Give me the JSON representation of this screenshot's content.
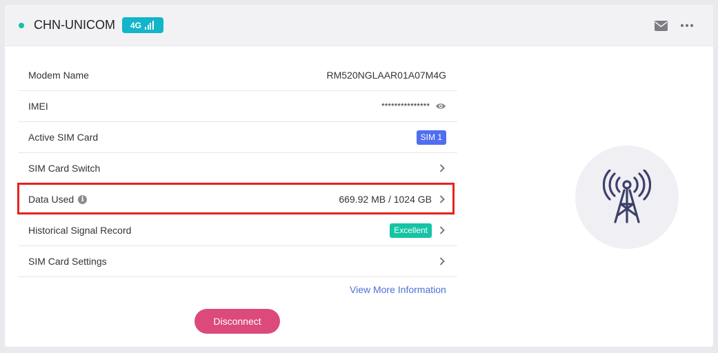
{
  "header": {
    "carrier": "CHN-UNICOM",
    "network_type": "4G",
    "status_color": "#13c2a6",
    "icons": [
      "mail-icon",
      "more-icon"
    ]
  },
  "rows": [
    {
      "label": "Modem Name",
      "value": "RM520NGLAAR01A07M4G"
    },
    {
      "label": "IMEI",
      "value": "***************",
      "icon": "eye-icon"
    },
    {
      "label": "Active SIM Card",
      "badge": "SIM 1"
    },
    {
      "label": "SIM Card Switch",
      "icon": "chevron-right-icon"
    },
    {
      "label": "Data Used",
      "value": "669.92 MB / 1024 GB",
      "icon": "chevron-right-icon",
      "highlighted": true
    },
    {
      "label": "Historical Signal Record",
      "badge": "Excellent",
      "icon": "chevron-right-icon"
    },
    {
      "label": "SIM Card Settings",
      "icon": "chevron-right-icon"
    }
  ],
  "info_glyph": "i",
  "more_link": "View More Information",
  "disconnect_label": "Disconnect",
  "colors": {
    "accent_link": "#4b70d6",
    "disconnect": "#dc4a7c",
    "sim_badge": "#4f6ef2",
    "excellent_badge": "#14c4a5",
    "highlight": "#e8231f",
    "tower": "#3d3f6b"
  }
}
